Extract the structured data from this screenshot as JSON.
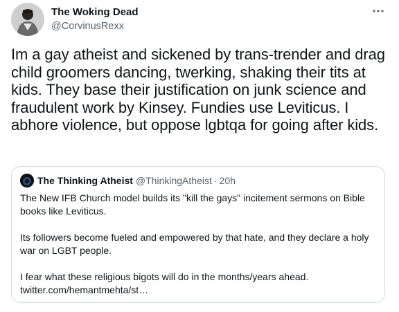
{
  "author": {
    "display_name": "The Woking Dead",
    "handle": "@CorvinusRexx"
  },
  "tweet": {
    "text": "Im a gay atheist and sickened by trans-trender and drag child groomers dancing, twerking, shaking their tits at kids.  They base their justification on junk science and fraudulent work by Kinsey. Fundies use Leviticus. I abhore violence, but oppose lgbtqa for going after kids."
  },
  "quoted_tweet": {
    "display_name": "The Thinking Atheist",
    "handle": "@ThinkingAtheist",
    "separator": "·",
    "time": "20h",
    "paragraphs": [
      "The New IFB Church model builds its \"kill the gays\" incitement sermons on Bible books like Leviticus.",
      "Its followers become fueled and empowered by that hate, and they declare a holy war on LGBT people.",
      "I fear what these religious bigots will do in the months/years ahead.",
      "twitter.com/hemantmehta/st…"
    ]
  },
  "icons": {
    "more": "more-horizontal-icon"
  },
  "colors": {
    "text": "#0f1419",
    "secondary": "#536471",
    "border": "#cfd9de"
  }
}
